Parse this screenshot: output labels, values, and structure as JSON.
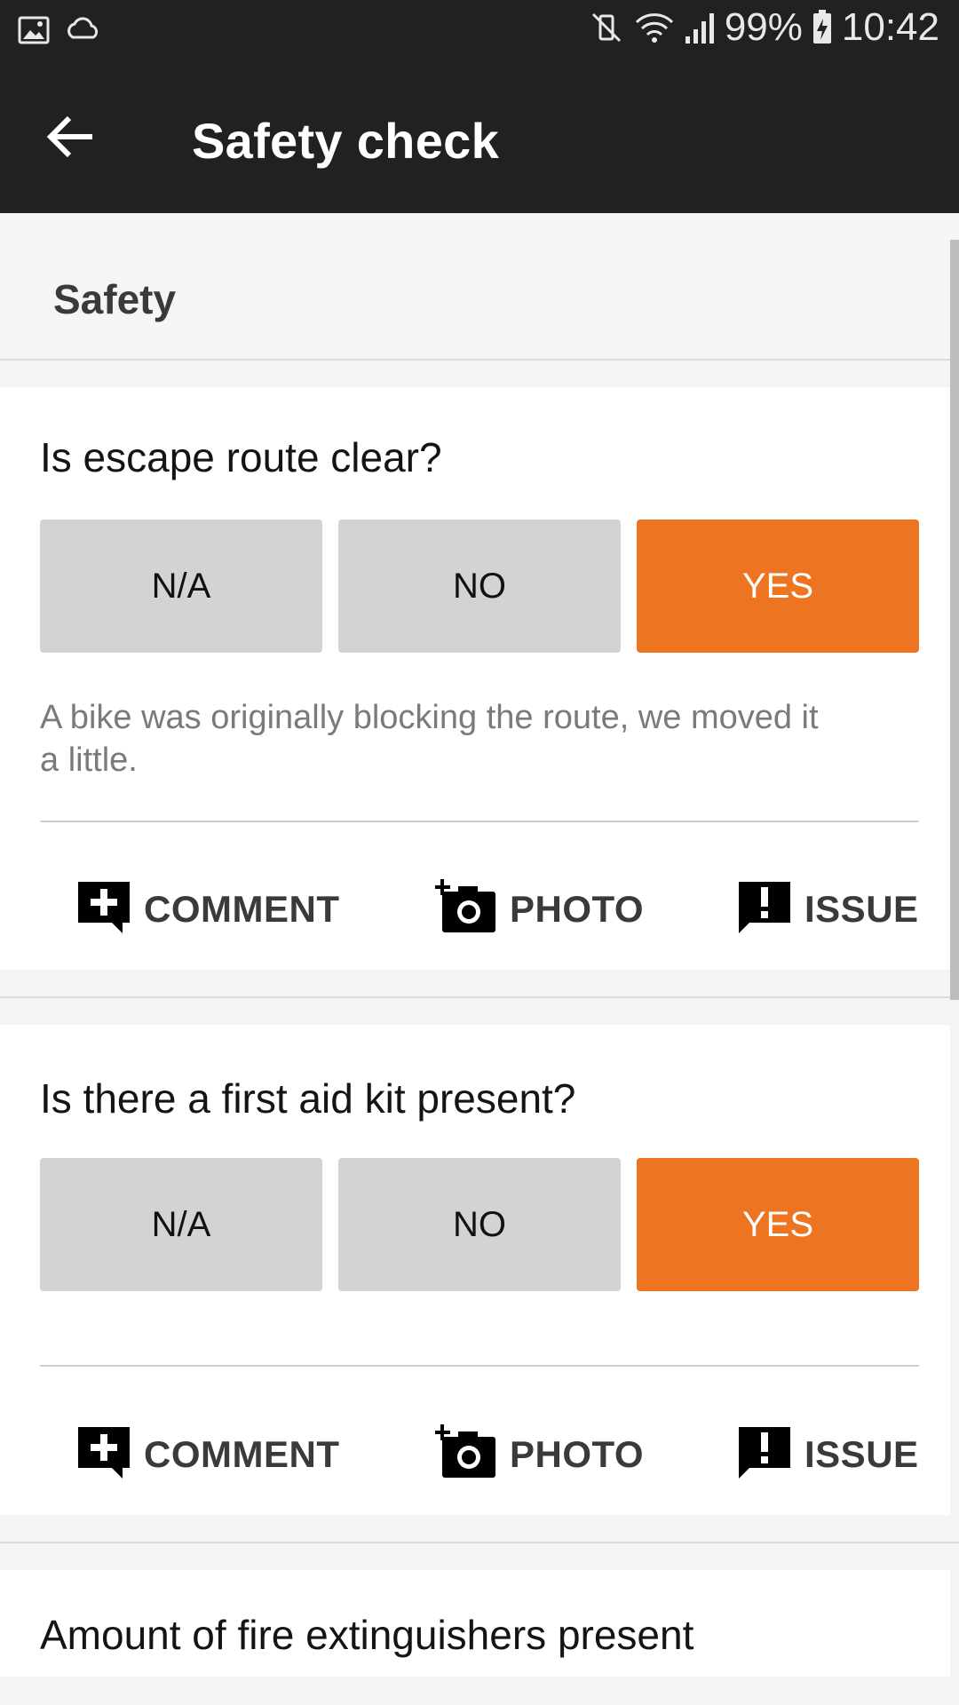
{
  "status_bar": {
    "battery": "99%",
    "time": "10:42"
  },
  "app_bar": {
    "title": "Safety check"
  },
  "section": {
    "title": "Safety"
  },
  "questions": [
    {
      "text": "Is escape route clear?",
      "options": [
        "N/A",
        "NO",
        "YES"
      ],
      "selected": "YES",
      "comment": "A bike was originally blocking the route, we moved it a little."
    },
    {
      "text": "Is there a first aid kit present?",
      "options": [
        "N/A",
        "NO",
        "YES"
      ],
      "selected": "YES",
      "comment": ""
    },
    {
      "text": "Amount of fire extinguishers present"
    }
  ],
  "actions": {
    "comment": "COMMENT",
    "photo": "PHOTO",
    "issue": "ISSUE"
  },
  "colors": {
    "accent": "#ed7522",
    "bar": "#212121",
    "neutral_button": "#d3d3d3"
  }
}
